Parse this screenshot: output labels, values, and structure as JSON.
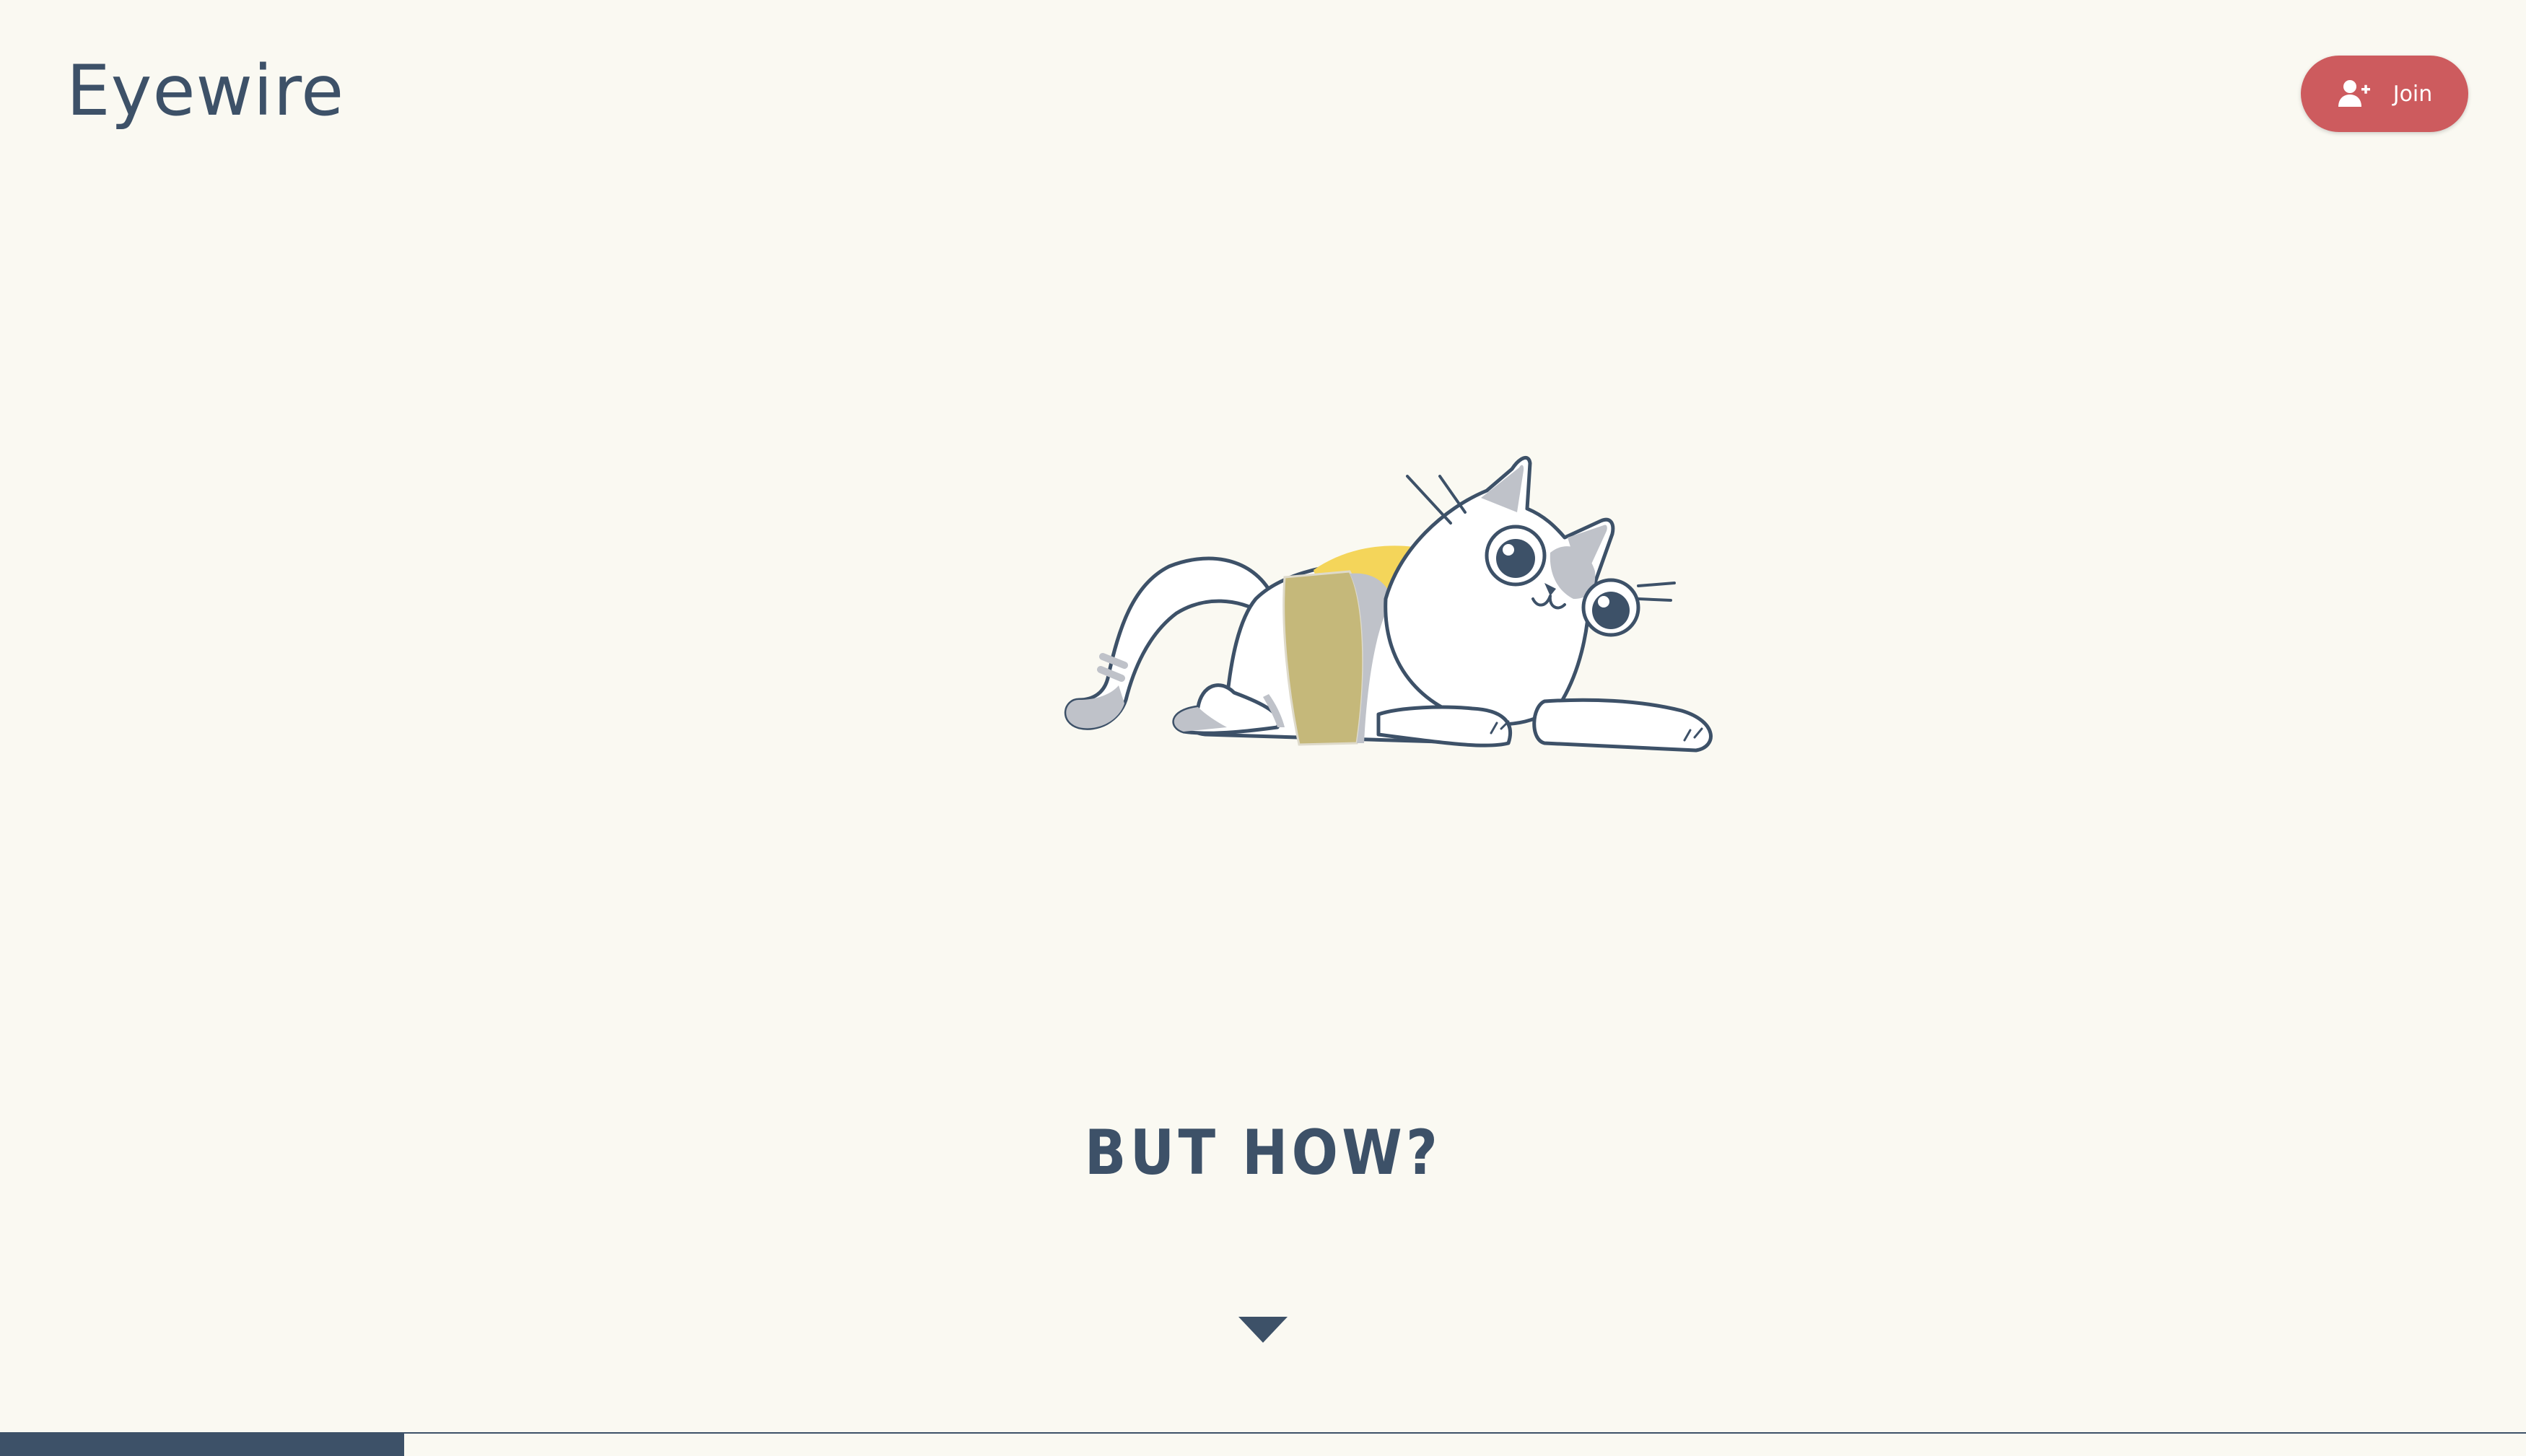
{
  "header": {
    "logo_text": "Eyewire",
    "join_label": "Join"
  },
  "hero": {
    "illustration": "cat-illustration",
    "headline": "BUT HOW?"
  },
  "icons": {
    "join": "user-plus-icon",
    "scroll": "chevron-down-icon"
  },
  "progress": {
    "fraction": 0.16
  },
  "colors": {
    "background": "#faf9f2",
    "primary": "#3d5168",
    "accent": "#cd5b5e",
    "highlight_yellow": "#f4d55a",
    "highlight_olive": "#c5b87a",
    "cat_gray": "#bfc2c9"
  }
}
